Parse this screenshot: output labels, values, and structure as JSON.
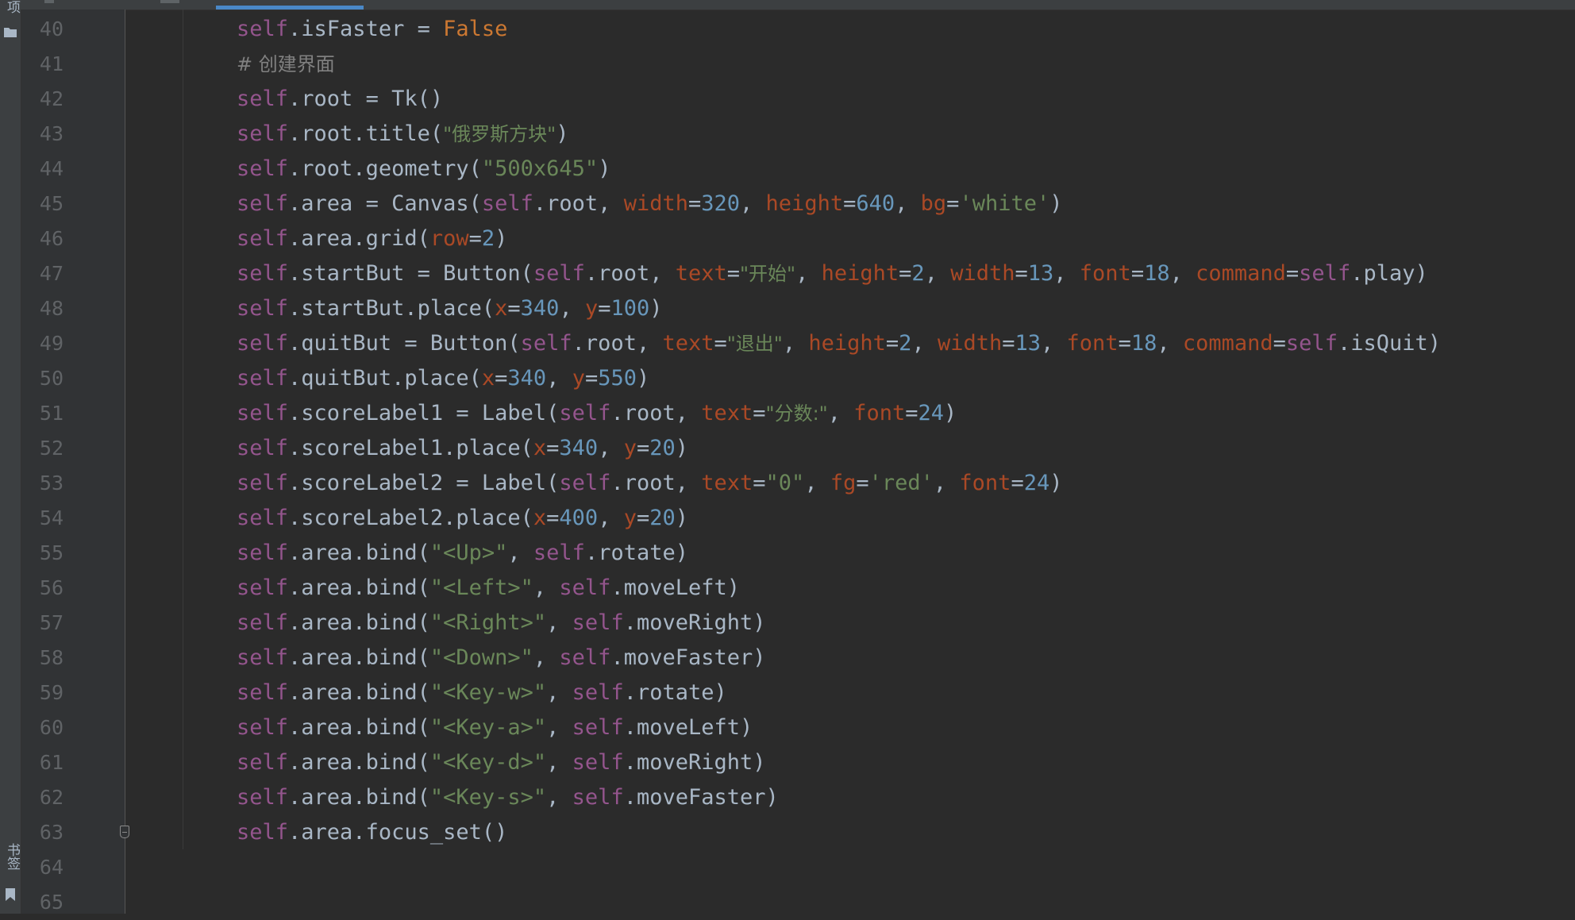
{
  "editor": {
    "lines": [
      {
        "num": "40",
        "tokens": [
          {
            "t": "self",
            "c": "self"
          },
          {
            "t": ".isFaster = ",
            "c": "plain"
          },
          {
            "t": "False",
            "c": "kw"
          }
        ]
      },
      {
        "num": "41",
        "tokens": [
          {
            "t": "# 创建界面",
            "c": "com"
          }
        ]
      },
      {
        "num": "42",
        "tokens": [
          {
            "t": "self",
            "c": "self"
          },
          {
            "t": ".root = Tk()",
            "c": "plain"
          }
        ]
      },
      {
        "num": "43",
        "tokens": [
          {
            "t": "self",
            "c": "self"
          },
          {
            "t": ".root.title(",
            "c": "plain"
          },
          {
            "t": "\"俄罗斯方块\"",
            "c": "str"
          },
          {
            "t": ")",
            "c": "plain"
          }
        ]
      },
      {
        "num": "44",
        "tokens": [
          {
            "t": "self",
            "c": "self"
          },
          {
            "t": ".root.geometry(",
            "c": "plain"
          },
          {
            "t": "\"500x645\"",
            "c": "str"
          },
          {
            "t": ")",
            "c": "plain"
          }
        ]
      },
      {
        "num": "45",
        "tokens": [
          {
            "t": "self",
            "c": "self"
          },
          {
            "t": ".area = Canvas(",
            "c": "plain"
          },
          {
            "t": "self",
            "c": "self"
          },
          {
            "t": ".root, ",
            "c": "plain"
          },
          {
            "t": "width",
            "c": "kwarg"
          },
          {
            "t": "=",
            "c": "plain"
          },
          {
            "t": "320",
            "c": "num"
          },
          {
            "t": ", ",
            "c": "plain"
          },
          {
            "t": "height",
            "c": "kwarg"
          },
          {
            "t": "=",
            "c": "plain"
          },
          {
            "t": "640",
            "c": "num"
          },
          {
            "t": ", ",
            "c": "plain"
          },
          {
            "t": "bg",
            "c": "kwarg"
          },
          {
            "t": "=",
            "c": "plain"
          },
          {
            "t": "'white'",
            "c": "str"
          },
          {
            "t": ")",
            "c": "plain"
          }
        ]
      },
      {
        "num": "46",
        "tokens": [
          {
            "t": "self",
            "c": "self"
          },
          {
            "t": ".area.grid(",
            "c": "plain"
          },
          {
            "t": "row",
            "c": "kwarg"
          },
          {
            "t": "=",
            "c": "plain"
          },
          {
            "t": "2",
            "c": "num"
          },
          {
            "t": ")",
            "c": "plain"
          }
        ]
      },
      {
        "num": "47",
        "tokens": [
          {
            "t": "self",
            "c": "self"
          },
          {
            "t": ".startBut = Button(",
            "c": "plain"
          },
          {
            "t": "self",
            "c": "self"
          },
          {
            "t": ".root, ",
            "c": "plain"
          },
          {
            "t": "text",
            "c": "kwarg"
          },
          {
            "t": "=",
            "c": "plain"
          },
          {
            "t": "\"开始\"",
            "c": "str"
          },
          {
            "t": ", ",
            "c": "plain"
          },
          {
            "t": "height",
            "c": "kwarg"
          },
          {
            "t": "=",
            "c": "plain"
          },
          {
            "t": "2",
            "c": "num"
          },
          {
            "t": ", ",
            "c": "plain"
          },
          {
            "t": "width",
            "c": "kwarg"
          },
          {
            "t": "=",
            "c": "plain"
          },
          {
            "t": "13",
            "c": "num"
          },
          {
            "t": ", ",
            "c": "plain"
          },
          {
            "t": "font",
            "c": "kwarg"
          },
          {
            "t": "=",
            "c": "plain"
          },
          {
            "t": "18",
            "c": "num"
          },
          {
            "t": ", ",
            "c": "plain"
          },
          {
            "t": "command",
            "c": "kwarg"
          },
          {
            "t": "=",
            "c": "plain"
          },
          {
            "t": "self",
            "c": "self"
          },
          {
            "t": ".play)",
            "c": "plain"
          }
        ]
      },
      {
        "num": "48",
        "tokens": [
          {
            "t": "self",
            "c": "self"
          },
          {
            "t": ".startBut.place(",
            "c": "plain"
          },
          {
            "t": "x",
            "c": "kwarg"
          },
          {
            "t": "=",
            "c": "plain"
          },
          {
            "t": "340",
            "c": "num"
          },
          {
            "t": ", ",
            "c": "plain"
          },
          {
            "t": "y",
            "c": "kwarg"
          },
          {
            "t": "=",
            "c": "plain"
          },
          {
            "t": "100",
            "c": "num"
          },
          {
            "t": ")",
            "c": "plain"
          }
        ]
      },
      {
        "num": "49",
        "tokens": [
          {
            "t": "self",
            "c": "self"
          },
          {
            "t": ".quitBut = Button(",
            "c": "plain"
          },
          {
            "t": "self",
            "c": "self"
          },
          {
            "t": ".root, ",
            "c": "plain"
          },
          {
            "t": "text",
            "c": "kwarg"
          },
          {
            "t": "=",
            "c": "plain"
          },
          {
            "t": "\"退出\"",
            "c": "str"
          },
          {
            "t": ", ",
            "c": "plain"
          },
          {
            "t": "height",
            "c": "kwarg"
          },
          {
            "t": "=",
            "c": "plain"
          },
          {
            "t": "2",
            "c": "num"
          },
          {
            "t": ", ",
            "c": "plain"
          },
          {
            "t": "width",
            "c": "kwarg"
          },
          {
            "t": "=",
            "c": "plain"
          },
          {
            "t": "13",
            "c": "num"
          },
          {
            "t": ", ",
            "c": "plain"
          },
          {
            "t": "font",
            "c": "kwarg"
          },
          {
            "t": "=",
            "c": "plain"
          },
          {
            "t": "18",
            "c": "num"
          },
          {
            "t": ", ",
            "c": "plain"
          },
          {
            "t": "command",
            "c": "kwarg"
          },
          {
            "t": "=",
            "c": "plain"
          },
          {
            "t": "self",
            "c": "self"
          },
          {
            "t": ".isQuit)",
            "c": "plain"
          }
        ]
      },
      {
        "num": "50",
        "tokens": [
          {
            "t": "self",
            "c": "self"
          },
          {
            "t": ".quitBut.place(",
            "c": "plain"
          },
          {
            "t": "x",
            "c": "kwarg"
          },
          {
            "t": "=",
            "c": "plain"
          },
          {
            "t": "340",
            "c": "num"
          },
          {
            "t": ", ",
            "c": "plain"
          },
          {
            "t": "y",
            "c": "kwarg"
          },
          {
            "t": "=",
            "c": "plain"
          },
          {
            "t": "550",
            "c": "num"
          },
          {
            "t": ")",
            "c": "plain"
          }
        ]
      },
      {
        "num": "51",
        "tokens": [
          {
            "t": "self",
            "c": "self"
          },
          {
            "t": ".scoreLabel1 = Label(",
            "c": "plain"
          },
          {
            "t": "self",
            "c": "self"
          },
          {
            "t": ".root, ",
            "c": "plain"
          },
          {
            "t": "text",
            "c": "kwarg"
          },
          {
            "t": "=",
            "c": "plain"
          },
          {
            "t": "\"分数:\"",
            "c": "str"
          },
          {
            "t": ", ",
            "c": "plain"
          },
          {
            "t": "font",
            "c": "kwarg"
          },
          {
            "t": "=",
            "c": "plain"
          },
          {
            "t": "24",
            "c": "num"
          },
          {
            "t": ")",
            "c": "plain"
          }
        ]
      },
      {
        "num": "52",
        "tokens": [
          {
            "t": "self",
            "c": "self"
          },
          {
            "t": ".scoreLabel1.place(",
            "c": "plain"
          },
          {
            "t": "x",
            "c": "kwarg"
          },
          {
            "t": "=",
            "c": "plain"
          },
          {
            "t": "340",
            "c": "num"
          },
          {
            "t": ", ",
            "c": "plain"
          },
          {
            "t": "y",
            "c": "kwarg"
          },
          {
            "t": "=",
            "c": "plain"
          },
          {
            "t": "20",
            "c": "num"
          },
          {
            "t": ")",
            "c": "plain"
          }
        ]
      },
      {
        "num": "53",
        "tokens": [
          {
            "t": "self",
            "c": "self"
          },
          {
            "t": ".scoreLabel2 = Label(",
            "c": "plain"
          },
          {
            "t": "self",
            "c": "self"
          },
          {
            "t": ".root, ",
            "c": "plain"
          },
          {
            "t": "text",
            "c": "kwarg"
          },
          {
            "t": "=",
            "c": "plain"
          },
          {
            "t": "\"0\"",
            "c": "str"
          },
          {
            "t": ", ",
            "c": "plain"
          },
          {
            "t": "fg",
            "c": "kwarg"
          },
          {
            "t": "=",
            "c": "plain"
          },
          {
            "t": "'red'",
            "c": "str"
          },
          {
            "t": ", ",
            "c": "plain"
          },
          {
            "t": "font",
            "c": "kwarg"
          },
          {
            "t": "=",
            "c": "plain"
          },
          {
            "t": "24",
            "c": "num"
          },
          {
            "t": ")",
            "c": "plain"
          }
        ]
      },
      {
        "num": "54",
        "tokens": [
          {
            "t": "self",
            "c": "self"
          },
          {
            "t": ".scoreLabel2.place(",
            "c": "plain"
          },
          {
            "t": "x",
            "c": "kwarg"
          },
          {
            "t": "=",
            "c": "plain"
          },
          {
            "t": "400",
            "c": "num"
          },
          {
            "t": ", ",
            "c": "plain"
          },
          {
            "t": "y",
            "c": "kwarg"
          },
          {
            "t": "=",
            "c": "plain"
          },
          {
            "t": "20",
            "c": "num"
          },
          {
            "t": ")",
            "c": "plain"
          }
        ]
      },
      {
        "num": "55",
        "tokens": [
          {
            "t": "self",
            "c": "self"
          },
          {
            "t": ".area.bind(",
            "c": "plain"
          },
          {
            "t": "\"<Up>\"",
            "c": "str"
          },
          {
            "t": ", ",
            "c": "plain"
          },
          {
            "t": "self",
            "c": "self"
          },
          {
            "t": ".rotate)",
            "c": "plain"
          }
        ]
      },
      {
        "num": "56",
        "tokens": [
          {
            "t": "self",
            "c": "self"
          },
          {
            "t": ".area.bind(",
            "c": "plain"
          },
          {
            "t": "\"<Left>\"",
            "c": "str"
          },
          {
            "t": ", ",
            "c": "plain"
          },
          {
            "t": "self",
            "c": "self"
          },
          {
            "t": ".moveLeft)",
            "c": "plain"
          }
        ]
      },
      {
        "num": "57",
        "tokens": [
          {
            "t": "self",
            "c": "self"
          },
          {
            "t": ".area.bind(",
            "c": "plain"
          },
          {
            "t": "\"<Right>\"",
            "c": "str"
          },
          {
            "t": ", ",
            "c": "plain"
          },
          {
            "t": "self",
            "c": "self"
          },
          {
            "t": ".moveRight)",
            "c": "plain"
          }
        ]
      },
      {
        "num": "58",
        "tokens": [
          {
            "t": "self",
            "c": "self"
          },
          {
            "t": ".area.bind(",
            "c": "plain"
          },
          {
            "t": "\"<Down>\"",
            "c": "str"
          },
          {
            "t": ", ",
            "c": "plain"
          },
          {
            "t": "self",
            "c": "self"
          },
          {
            "t": ".moveFaster)",
            "c": "plain"
          }
        ]
      },
      {
        "num": "59",
        "tokens": [
          {
            "t": "self",
            "c": "self"
          },
          {
            "t": ".area.bind(",
            "c": "plain"
          },
          {
            "t": "\"<Key-w>\"",
            "c": "str"
          },
          {
            "t": ", ",
            "c": "plain"
          },
          {
            "t": "self",
            "c": "self"
          },
          {
            "t": ".rotate)",
            "c": "plain"
          }
        ]
      },
      {
        "num": "60",
        "tokens": [
          {
            "t": "self",
            "c": "self"
          },
          {
            "t": ".area.bind(",
            "c": "plain"
          },
          {
            "t": "\"<Key-a>\"",
            "c": "str"
          },
          {
            "t": ", ",
            "c": "plain"
          },
          {
            "t": "self",
            "c": "self"
          },
          {
            "t": ".moveLeft)",
            "c": "plain"
          }
        ]
      },
      {
        "num": "61",
        "tokens": [
          {
            "t": "self",
            "c": "self"
          },
          {
            "t": ".area.bind(",
            "c": "plain"
          },
          {
            "t": "\"<Key-d>\"",
            "c": "str"
          },
          {
            "t": ", ",
            "c": "plain"
          },
          {
            "t": "self",
            "c": "self"
          },
          {
            "t": ".moveRight)",
            "c": "plain"
          }
        ]
      },
      {
        "num": "62",
        "tokens": [
          {
            "t": "self",
            "c": "self"
          },
          {
            "t": ".area.bind(",
            "c": "plain"
          },
          {
            "t": "\"<Key-s>\"",
            "c": "str"
          },
          {
            "t": ", ",
            "c": "plain"
          },
          {
            "t": "self",
            "c": "self"
          },
          {
            "t": ".moveFaster)",
            "c": "plain"
          }
        ]
      },
      {
        "num": "63",
        "tokens": [
          {
            "t": "self",
            "c": "self"
          },
          {
            "t": ".area.focus_set()",
            "c": "plain"
          }
        ]
      },
      {
        "num": "64",
        "tokens": []
      },
      {
        "num": "65",
        "tokens": []
      }
    ]
  },
  "sidebar": {
    "top_label": "项",
    "bottom_label": "书签",
    "icons": [
      "folder-icon",
      "bookmark-icon"
    ]
  },
  "colors": {
    "background": "#2b2b2b",
    "gutter": "#313335",
    "self": "#94558d",
    "keyword": "#cc7832",
    "kwarg": "#aa4926",
    "number": "#6897bb",
    "string": "#6a8759",
    "comment": "#808080",
    "plain": "#a9b7c6",
    "tab_accent": "#4a88c7"
  }
}
